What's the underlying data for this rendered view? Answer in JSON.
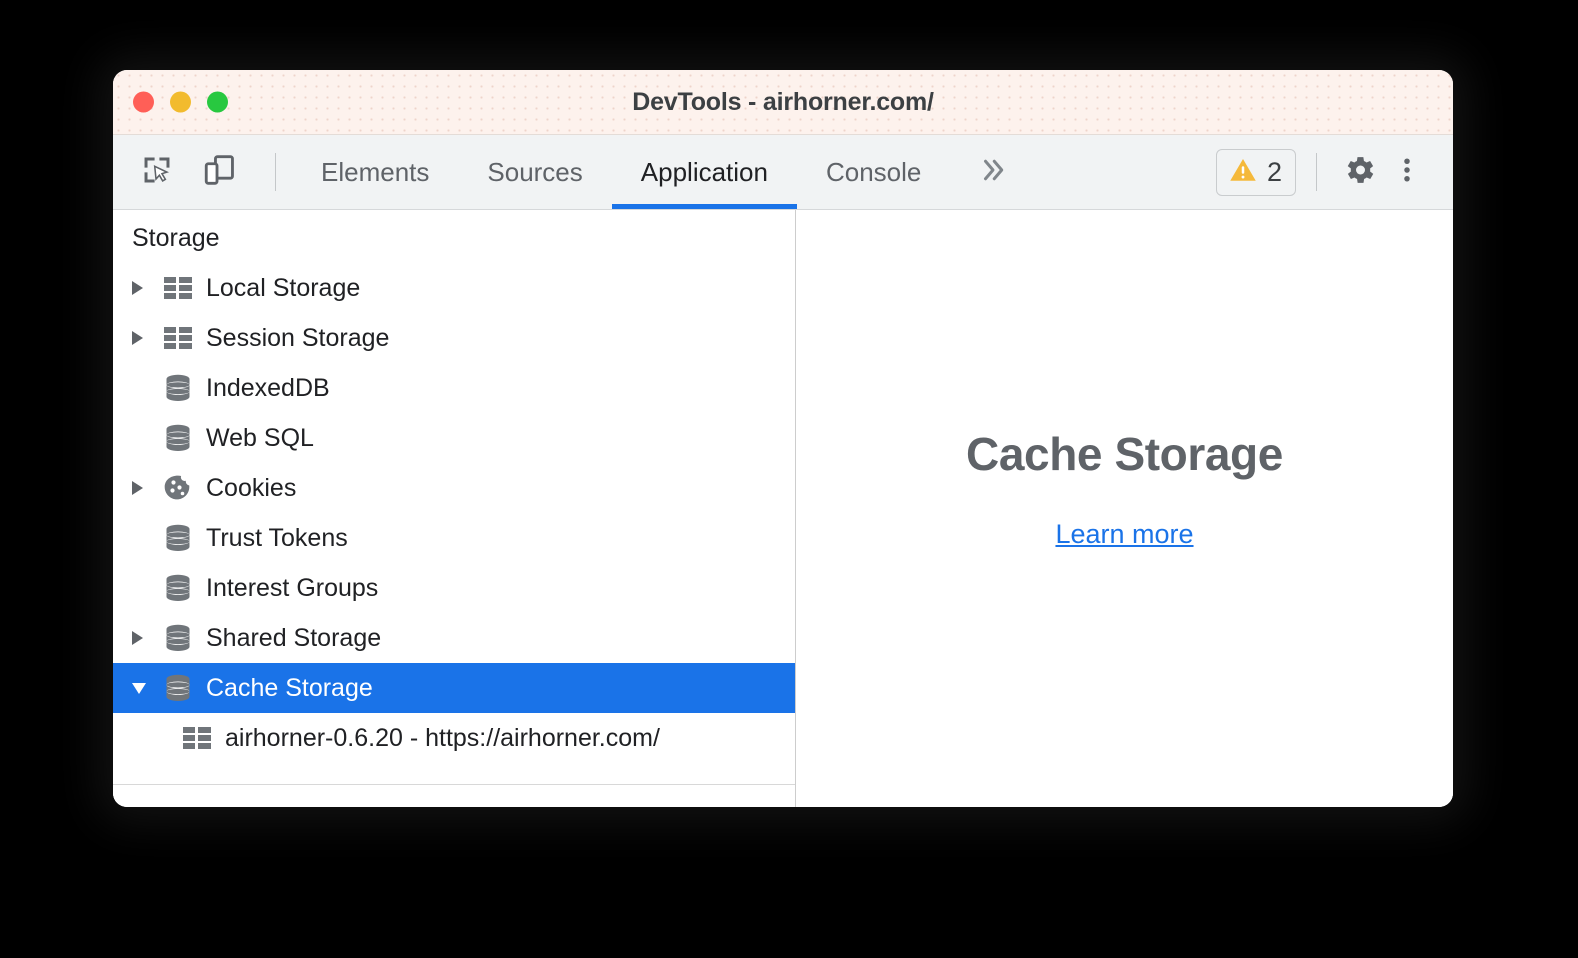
{
  "window": {
    "title": "DevTools - airhorner.com/",
    "traffic_lights": [
      "close",
      "minimize",
      "maximize"
    ],
    "colors": {
      "close": "#ff5f57",
      "minimize": "#f2bb2e",
      "maximize": "#28c840",
      "accent": "#1a73e8",
      "warning": "#f5b93b",
      "titlebar_bg": "#fdf2ed",
      "tabbar_bg": "#f1f3f4"
    }
  },
  "toolbar": {
    "left_buttons": [
      {
        "name": "inspect-element-icon",
        "label": "Inspect element"
      },
      {
        "name": "device-toolbar-icon",
        "label": "Toggle device toolbar"
      }
    ],
    "tabs": [
      {
        "label": "Elements",
        "selected": false
      },
      {
        "label": "Sources",
        "selected": false
      },
      {
        "label": "Application",
        "selected": true
      },
      {
        "label": "Console",
        "selected": false
      }
    ],
    "more_tabs_label": "»",
    "warning_count": "2",
    "warning_icon": "warning-triangle-icon",
    "settings_icon": "gear-icon",
    "menu_icon": "more-vertical-icon"
  },
  "sidebar": {
    "section_title": "Storage",
    "items": [
      {
        "label": "Local Storage",
        "icon": "table-grid-icon",
        "twisty": "right",
        "selected": false,
        "indent": 0
      },
      {
        "label": "Session Storage",
        "icon": "table-grid-icon",
        "twisty": "right",
        "selected": false,
        "indent": 0
      },
      {
        "label": "IndexedDB",
        "icon": "database-icon",
        "twisty": "none",
        "selected": false,
        "indent": 0
      },
      {
        "label": "Web SQL",
        "icon": "database-icon",
        "twisty": "none",
        "selected": false,
        "indent": 0
      },
      {
        "label": "Cookies",
        "icon": "cookie-icon",
        "twisty": "right",
        "selected": false,
        "indent": 0
      },
      {
        "label": "Trust Tokens",
        "icon": "database-icon",
        "twisty": "none",
        "selected": false,
        "indent": 0
      },
      {
        "label": "Interest Groups",
        "icon": "database-icon",
        "twisty": "none",
        "selected": false,
        "indent": 0
      },
      {
        "label": "Shared Storage",
        "icon": "database-icon",
        "twisty": "right",
        "selected": false,
        "indent": 0
      },
      {
        "label": "Cache Storage",
        "icon": "database-icon",
        "twisty": "down",
        "selected": true,
        "indent": 0
      },
      {
        "label": "airhorner-0.6.20 - https://airhorner.com/",
        "icon": "table-grid-icon",
        "twisty": "none",
        "selected": false,
        "indent": 1
      }
    ]
  },
  "main": {
    "title": "Cache Storage",
    "link_label": "Learn more"
  }
}
